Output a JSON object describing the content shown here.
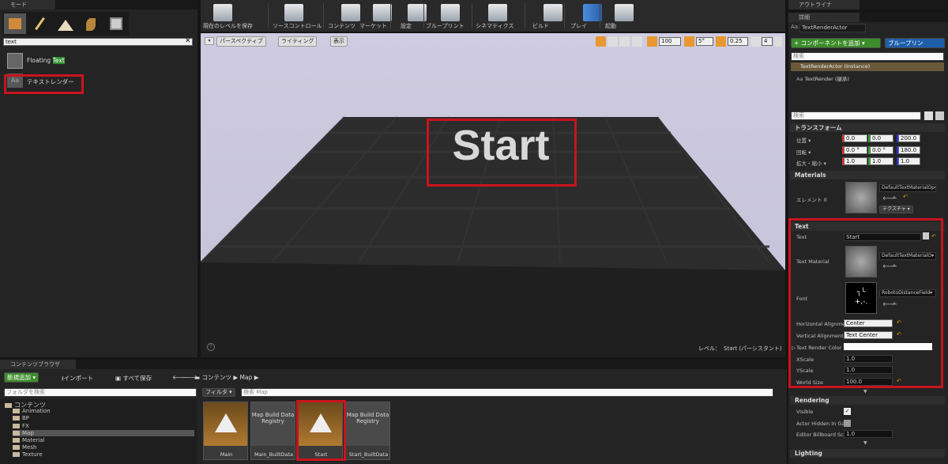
{
  "modes": {
    "tab": "モード",
    "search_value": "text",
    "items": [
      {
        "label": "Floating ",
        "highlight": "Text"
      },
      {
        "label": "テキストレンダー"
      }
    ]
  },
  "toolbar": {
    "buttons": [
      {
        "label": "現在のレベルを保存",
        "icon": "save-icon"
      },
      {
        "label": "ソースコントロール",
        "icon": "source-control-icon"
      },
      {
        "label": "コンテンツ",
        "icon": "content-icon"
      },
      {
        "label": "マーケット",
        "icon": "marketplace-icon"
      },
      {
        "label": "設定",
        "icon": "settings-icon"
      },
      {
        "label": "ブループリント",
        "icon": "blueprint-icon"
      },
      {
        "label": "シネマティクス",
        "icon": "cinematics-icon"
      },
      {
        "label": "ビルド",
        "icon": "build-icon"
      },
      {
        "label": "プレイ",
        "icon": "play-icon"
      },
      {
        "label": "起動",
        "icon": "launch-icon"
      }
    ]
  },
  "viewport": {
    "perspective": "パースペクティブ",
    "lighting": "ライティング",
    "show": "表示",
    "grid": "100",
    "angle": "5°",
    "scale": "0.25",
    "cam": "4",
    "text_actor": "Start",
    "level_label": "レベル：",
    "level_name": "Start (パーシスタント)"
  },
  "outliner": {
    "tab": "アウトライナ"
  },
  "details": {
    "tab": "詳細",
    "actor_name": "TextRenderActor",
    "add_component": "+ コンポーネントを追加 ▾",
    "blueprint": "ブループリン",
    "search_placeholder": "検索",
    "instance": "TextRenderActor (Instance)",
    "component": "TextRender (継承)",
    "search2_placeholder": "検索",
    "transform": {
      "title": "トランスフォーム",
      "location_label": "位置 ▾",
      "rotation_label": "回転 ▾",
      "scale_label": "拡大・縮小 ▾",
      "location": [
        "0.0",
        "0.0",
        "200.0"
      ],
      "rotation": [
        "0.0 °",
        "0.0 °",
        "180.0"
      ],
      "scale": [
        "1.0",
        "1.0",
        "1.0"
      ]
    },
    "materials": {
      "title": "Materials",
      "element": "エレメント 0",
      "material": "DefaultTextMaterialOp▾",
      "texture": "テクスチャ ▾"
    },
    "text_section": {
      "title": "Text",
      "text_label": "Text",
      "text_value": "Start",
      "material_label": "Text Material",
      "material_value": "DefaultTextMaterialO▾",
      "font_label": "Font",
      "font_value": "RobotoDistanceField▾",
      "halign_label": "Horizontal Alignme",
      "halign_value": "Center",
      "valign_label": "Vertical Alignment",
      "valign_value": "Text Center",
      "color_label": "Text Render Color",
      "xscale_label": "XScale",
      "xscale_value": "1.0",
      "yscale_label": "YScale",
      "yscale_value": "1.0",
      "size_label": "World Size",
      "size_value": "100.0"
    },
    "rendering": {
      "title": "Rendering",
      "visible": "Visible",
      "hidden": "Actor Hidden In Gar",
      "billboard": "Editor Billboard Sca",
      "billboard_value": "1.0"
    },
    "lighting": {
      "title": "Lighting"
    }
  },
  "content_browser": {
    "tab": "コンテンツブラウザ",
    "add_new": "新規追加 ▾",
    "import": "インポート",
    "save_all": "すべて保存",
    "path_root": "コンテンツ",
    "path_map": "Map",
    "folder_search": "フォルダを検索",
    "filter": "フィルタ ▾",
    "asset_search": "検索 Map",
    "tree": [
      "コンテンツ",
      "Animation",
      "BP",
      "FX",
      "Map",
      "Material",
      "Mesh",
      "Texture"
    ],
    "assets": [
      {
        "name": "Main",
        "type": "map"
      },
      {
        "name": "Main_BuiltData",
        "type": "data",
        "thumb": "Map Build Data Registry"
      },
      {
        "name": "Start",
        "type": "map"
      },
      {
        "name": "Start_BuiltData",
        "type": "data",
        "thumb": "Map Build Data Registry"
      }
    ]
  },
  "colors": {
    "accent_red": "#c8141e",
    "green": "#3c8c2a",
    "blue": "#1e5faa",
    "highlight_text": "#2e8b2e"
  }
}
